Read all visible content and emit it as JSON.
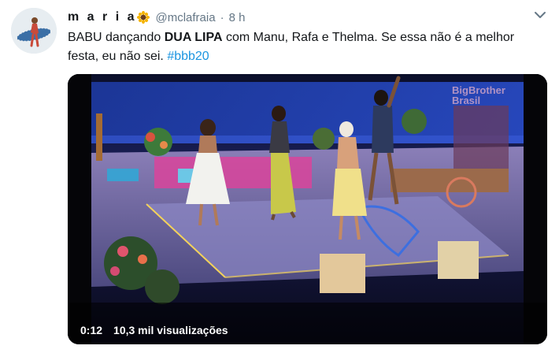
{
  "tweet": {
    "author_name": "m a r i a",
    "handle": "@mclafraia",
    "separator": "·",
    "time": "8 h",
    "text": {
      "t1": "BABU dançando ",
      "bold": "DUA LIPA",
      "t2": " com Manu, Rafa e Thelma. Se essa não é a melhor festa, eu não sei. ",
      "hashtag": "#bbb20"
    },
    "icons": {
      "avatar": "avatar-photo",
      "name_emoji": "sunflower-icon",
      "menu": "chevron-down-icon"
    }
  },
  "video": {
    "current_time": "0:12",
    "views": "10,3 mil visualizações",
    "watermark_line1": "BigBrother",
    "watermark_line2": "Brasil"
  },
  "colors": {
    "text": "#14171a",
    "secondary": "#657786",
    "link": "#1b95e0"
  }
}
